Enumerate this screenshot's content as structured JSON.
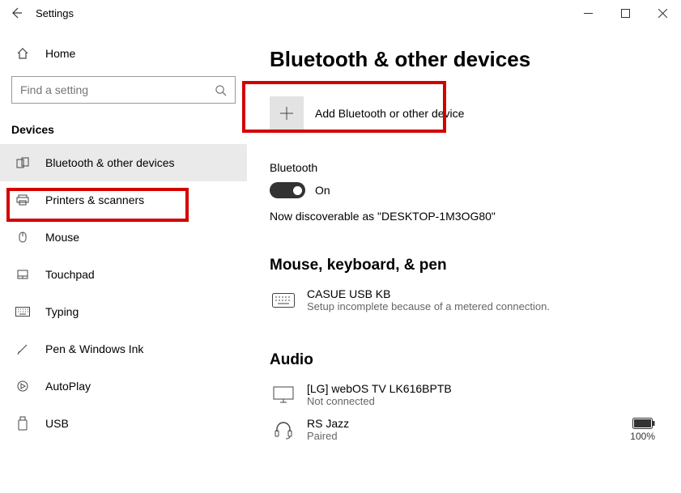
{
  "window": {
    "title": "Settings"
  },
  "sidebar": {
    "home_label": "Home",
    "search_placeholder": "Find a setting",
    "group_title": "Devices",
    "items": [
      {
        "label": "Bluetooth & other devices"
      },
      {
        "label": "Printers & scanners"
      },
      {
        "label": "Mouse"
      },
      {
        "label": "Touchpad"
      },
      {
        "label": "Typing"
      },
      {
        "label": "Pen & Windows Ink"
      },
      {
        "label": "AutoPlay"
      },
      {
        "label": "USB"
      }
    ]
  },
  "main": {
    "page_title": "Bluetooth & other devices",
    "add_button_label": "Add Bluetooth or other device",
    "bluetooth_label": "Bluetooth",
    "toggle_state": "On",
    "discoverable_text": "Now discoverable as \"DESKTOP-1M3OG80\"",
    "section1_title": "Mouse, keyboard, & pen",
    "section1_devices": [
      {
        "name": "CASUE USB KB",
        "status": "Setup incomplete because of a metered connection."
      }
    ],
    "section2_title": "Audio",
    "section2_devices": [
      {
        "name": "[LG] webOS TV LK616BPTB",
        "status": "Not connected"
      },
      {
        "name": "RS Jazz",
        "status": "Paired",
        "battery": "100%"
      }
    ]
  }
}
